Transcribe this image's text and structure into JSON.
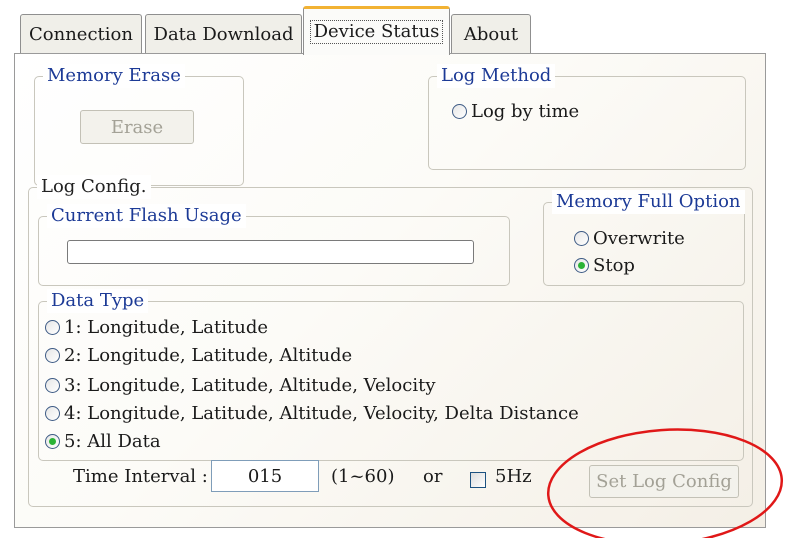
{
  "tabs": [
    {
      "label": "Connection"
    },
    {
      "label": "Data Download"
    },
    {
      "label": "Device Status"
    },
    {
      "label": "About"
    }
  ],
  "memory_erase": {
    "legend": "Memory Erase",
    "button": "Erase"
  },
  "log_method": {
    "legend": "Log Method",
    "option": "Log by time"
  },
  "log_config": {
    "legend": "Log Config."
  },
  "flash_usage": {
    "legend": "Current Flash Usage",
    "fill_fraction": 0
  },
  "memory_full": {
    "legend": "Memory Full Option",
    "options": [
      "Overwrite",
      "Stop"
    ],
    "selected": "Stop"
  },
  "data_type": {
    "legend": "Data Type",
    "options": [
      "1: Longitude, Latitude",
      "2: Longitude, Latitude, Altitude",
      "3: Longitude, Latitude, Altitude, Velocity",
      "4: Longitude, Latitude, Altitude, Velocity, Delta Distance",
      "5: All Data"
    ],
    "selected": "5: All Data"
  },
  "time_interval": {
    "label": "Time Interval :",
    "value": "015",
    "range": "(1~60)",
    "or_label": "or",
    "hz_label": "5Hz",
    "hz_checked": false
  },
  "set_log_button": "Set Log Config",
  "colors": {
    "legend_blue": "#1c3a96",
    "tab_highlight": "#f2b233",
    "radio_checked": "#2bb336",
    "annotation_red": "#e01818"
  }
}
